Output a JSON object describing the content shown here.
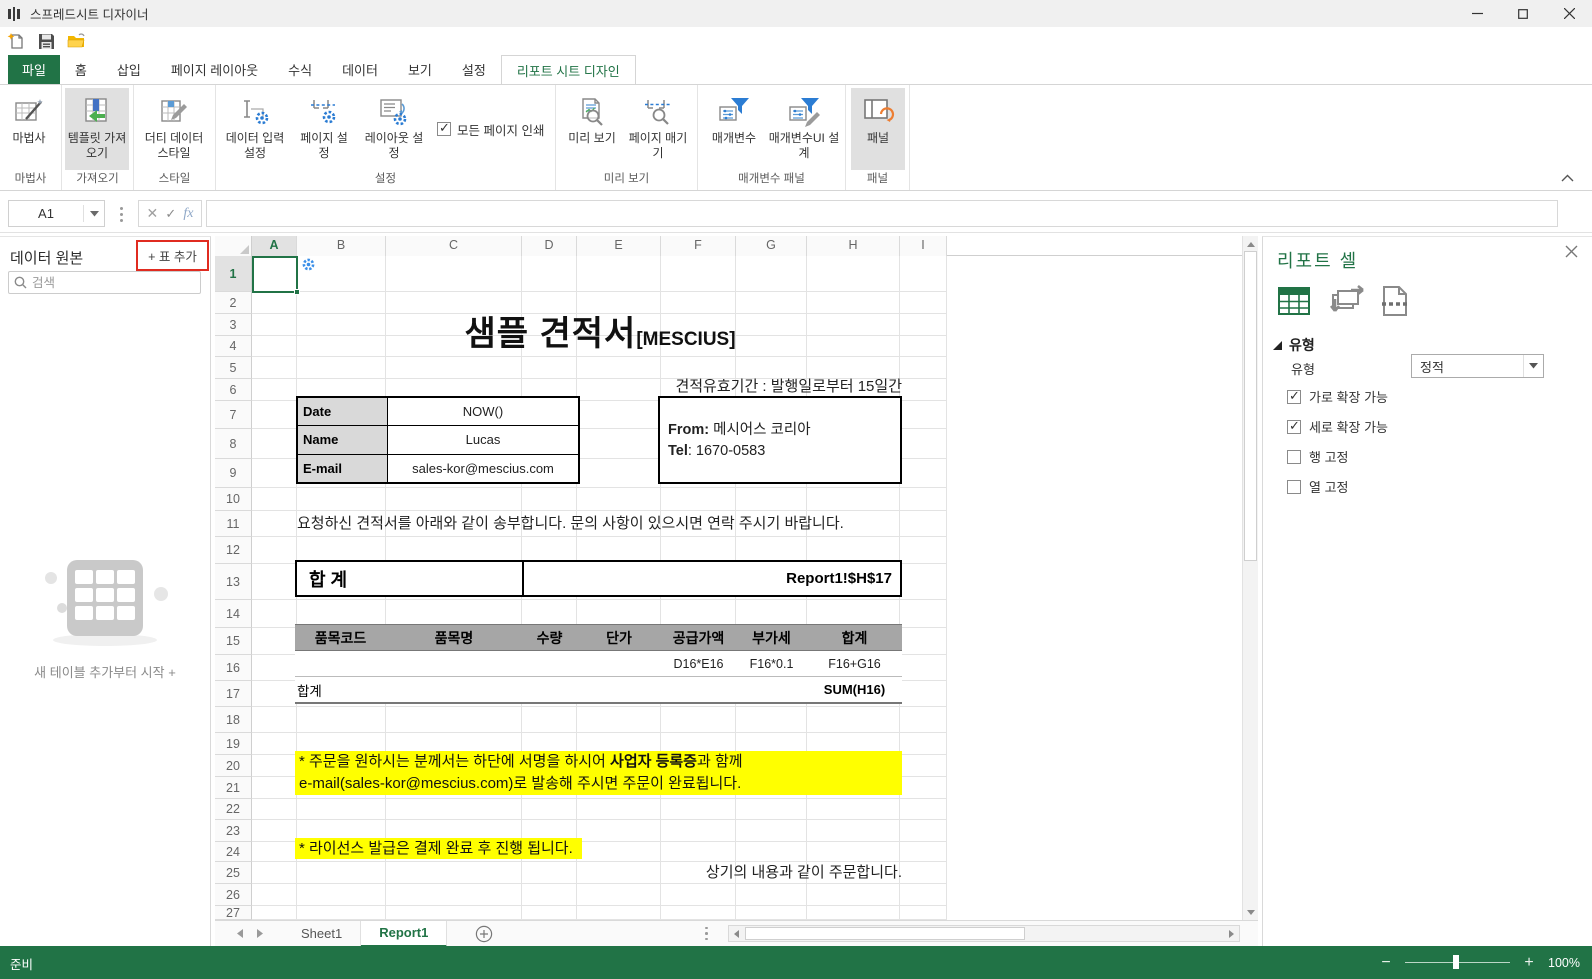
{
  "titlebar": {
    "app_title": "스프레드시트 디자이너"
  },
  "ribbon": {
    "tabs": [
      {
        "label": "파일"
      },
      {
        "label": "홈"
      },
      {
        "label": "삽입"
      },
      {
        "label": "페이지 레이아웃"
      },
      {
        "label": "수식"
      },
      {
        "label": "데이터"
      },
      {
        "label": "보기"
      },
      {
        "label": "설정"
      },
      {
        "label": "리포트 시트 디자인"
      }
    ],
    "buttons": {
      "wizard": "마법사",
      "import_template": "템플릿 가져오기",
      "dirty_style": "더티 데이터 스타일",
      "data_input": "데이터 입력 설정",
      "page_setup": "페이지 설정",
      "layout_setup": "레이아웃 설정",
      "print_all": "모든 페이지 인쇄",
      "preview": "미리 보기",
      "paginate": "페이지 매기기",
      "parameters": "매개변수",
      "param_ui": "매개변수UI 설계",
      "panel": "패널"
    },
    "print_all_checked": true,
    "group_labels": [
      "마법사",
      "가져오기",
      "스타일",
      "설정",
      "미리 보기",
      "매개변수 패널",
      "패널"
    ]
  },
  "formula_bar": {
    "cell_ref": "A1",
    "formula": "",
    "cancel_glyph": "✕",
    "enter_glyph": "✓",
    "fx_label": "fx"
  },
  "left_panel": {
    "title": "데이터 원본",
    "add_table_button": "+ 표 추가",
    "search_placeholder": "검색",
    "empty_cta": "새 테이블 추가부터 시작 +"
  },
  "sheet": {
    "columns": [
      "A",
      "B",
      "C",
      "D",
      "E",
      "F",
      "G",
      "H",
      "I"
    ],
    "row_count": 27,
    "active_cell": "A1",
    "doc": {
      "title": "샘플 견적서",
      "title_suffix": "[MESCIUS]",
      "validity": "견적유효기간 :  발행일로부터 15일간",
      "info_rows": [
        {
          "label": "Date",
          "value": "NOW()"
        },
        {
          "label": "Name",
          "value": "Lucas"
        },
        {
          "label": "E-mail",
          "value": "sales-kor@mescius.com"
        }
      ],
      "from_label": "From:",
      "from_value": " 메시어스 코리아",
      "tel_label": "Tel",
      "tel_value": ": 1670-0583",
      "greeting": "요청하신 견적서를 아래와 같이 송부합니다. 문의 사항이 있으시면 연락 주시기 바랍니다.",
      "total_label": "합 계",
      "total_ref": "Report1!$H$17",
      "items_header": [
        "품목코드",
        "품목명",
        "수량",
        "단가",
        "공급가액",
        "부가세",
        "합계"
      ],
      "formula_supply": "D16*E16",
      "formula_vat": "F16*0.1",
      "formula_total": "F16+G16",
      "items_total_label": "합계",
      "items_total_formula": "SUM(H16)",
      "note1_pre": "* 주문을 원하시는 분께서는 하단에 서명을 하시어 ",
      "note1_bold": "사업자 등록증",
      "note1_post": "과 함께",
      "note1_line2": " e-mail(sales-kor@mescius.com)로 발송해 주시면 주문이 완료됩니다.",
      "note2": "* 라이선스 발급은 결제 완료 후 진행 됩니다.",
      "closing": "상기의 내용과 같이 주문합니다."
    }
  },
  "tabs_bar": {
    "sheets": [
      {
        "label": "Sheet1",
        "active": false
      },
      {
        "label": "Report1",
        "active": true
      }
    ]
  },
  "report_panel": {
    "title": "리포트 셀",
    "section": "유형",
    "type_label": "유형",
    "type_value": "정적",
    "options": [
      {
        "label": "가로 확장 가능",
        "checked": true
      },
      {
        "label": "세로 확장 가능",
        "checked": true
      },
      {
        "label": "행 고정",
        "checked": false
      },
      {
        "label": "열 고정",
        "checked": false
      }
    ]
  },
  "status_bar": {
    "ready": "준비",
    "zoom_level": "100%"
  }
}
